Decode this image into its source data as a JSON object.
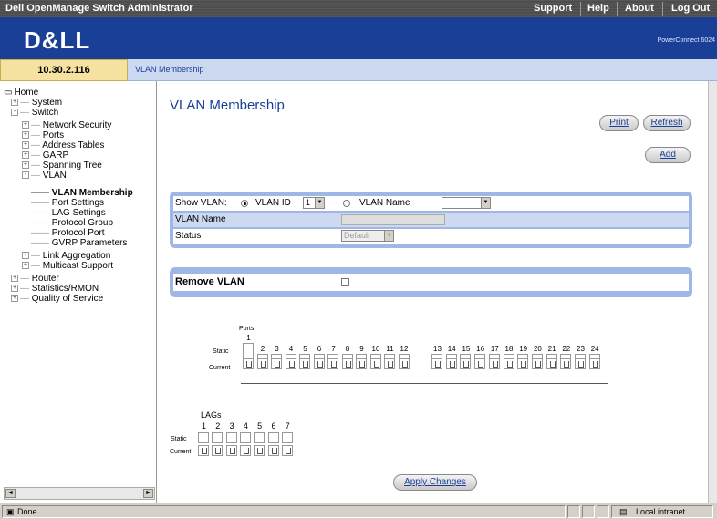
{
  "app": {
    "title": "Dell OpenManage Switch Administrator",
    "links": [
      "Support",
      "Help",
      "About",
      "Log Out"
    ],
    "logo": "D&LL",
    "model": "PowerConnect 6024"
  },
  "ip": "10.30.2.116",
  "breadcrumb": "VLAN Membership",
  "tree": [
    {
      "label": "Home",
      "indent": 0,
      "box": ""
    },
    {
      "label": "System",
      "indent": 1,
      "box": "+"
    },
    {
      "label": "Switch",
      "indent": 1,
      "box": "-"
    },
    {
      "label": "Network Security",
      "indent": 2,
      "box": "+"
    },
    {
      "label": "Ports",
      "indent": 2,
      "box": "+"
    },
    {
      "label": "Address Tables",
      "indent": 2,
      "box": "+"
    },
    {
      "label": "GARP",
      "indent": 2,
      "box": "+"
    },
    {
      "label": "Spanning Tree",
      "indent": 2,
      "box": "+"
    },
    {
      "label": "VLAN",
      "indent": 2,
      "box": "-"
    },
    {
      "label": "VLAN Membership",
      "indent": 3,
      "box": "",
      "selected": true
    },
    {
      "label": "Port Settings",
      "indent": 3,
      "box": ""
    },
    {
      "label": "LAG Settings",
      "indent": 3,
      "box": ""
    },
    {
      "label": "Protocol Group",
      "indent": 3,
      "box": ""
    },
    {
      "label": "Protocol Port",
      "indent": 3,
      "box": ""
    },
    {
      "label": "GVRP Parameters",
      "indent": 3,
      "box": ""
    },
    {
      "label": "Link Aggregation",
      "indent": 2,
      "box": "+"
    },
    {
      "label": "Multicast Support",
      "indent": 2,
      "box": "+"
    },
    {
      "label": "Router",
      "indent": 1,
      "box": "+"
    },
    {
      "label": "Statistics/RMON",
      "indent": 1,
      "box": "+"
    },
    {
      "label": "Quality of Service",
      "indent": 1,
      "box": "+"
    }
  ],
  "page": {
    "title": "VLAN Membership",
    "buttons": {
      "print": "Print",
      "refresh": "Refresh",
      "add": "Add",
      "apply": "Apply Changes"
    },
    "show_vlan": {
      "label": "Show VLAN:",
      "vlan_id_label": "VLAN ID",
      "vlan_id_value": "1",
      "vlan_name_label": "VLAN Name",
      "vlan_name_value": ""
    },
    "vlan_name_label": "VLAN Name",
    "status_label": "Status",
    "status_value": "Default",
    "remove_vlan": "Remove VLAN",
    "ports": {
      "caption": "Ports",
      "static": "Static",
      "current": "Current",
      "numbers": [
        "1",
        "2",
        "3",
        "4",
        "5",
        "6",
        "7",
        "8",
        "9",
        "10",
        "11",
        "12",
        "13",
        "14",
        "15",
        "16",
        "17",
        "18",
        "19",
        "20",
        "21",
        "22",
        "23",
        "24"
      ]
    },
    "lags": {
      "caption": "LAGs",
      "static": "Static",
      "current": "Current",
      "numbers": [
        "1",
        "2",
        "3",
        "4",
        "5",
        "6",
        "7"
      ]
    }
  },
  "statusbar": {
    "left": "Done",
    "right": "Local intranet"
  }
}
